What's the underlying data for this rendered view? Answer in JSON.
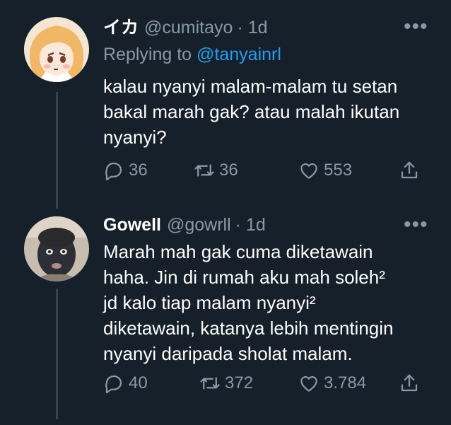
{
  "tweets": [
    {
      "name": "イカ",
      "handle": "@cumitayo",
      "time": "· 1d",
      "replying_prefix": "Replying to ",
      "replying_to": "@tanyainrl",
      "text": "kalau nyanyi malam-malam tu setan\nbakal marah gak? atau malah ikutan\nnyanyi?",
      "replies": "36",
      "retweets": "36",
      "likes": "553",
      "more": "•••"
    },
    {
      "name": "Gowell",
      "handle": "@gowrll",
      "time": "· 1d",
      "text": "Marah mah gak cuma diketawain\nhaha. Jin di rumah aku mah soleh²\njd kalo tiap malam nyanyi²\ndiketawain, katanya lebih mentingin\nnyanyi daripada sholat malam.",
      "replies": "40",
      "retweets": "372",
      "likes": "3.784",
      "more": "•••"
    }
  ],
  "colors": {
    "background": "#15202b",
    "secondary_text": "#8899a6",
    "link": "#1da1f2",
    "thread_line": "#38444d"
  },
  "icons": [
    "reply-icon",
    "retweet-icon",
    "like-icon",
    "share-icon",
    "more-icon"
  ]
}
